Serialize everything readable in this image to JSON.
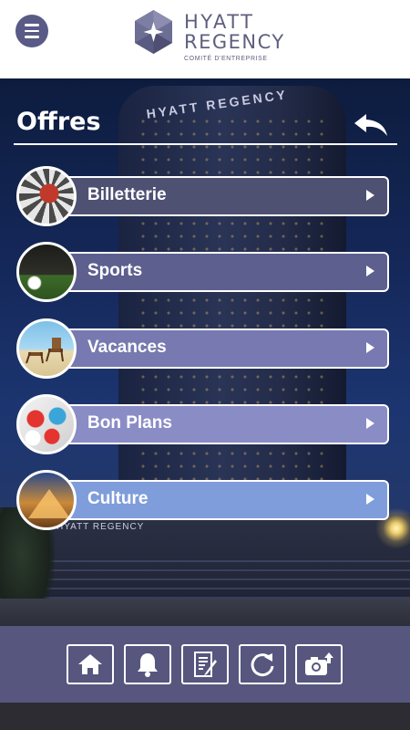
{
  "header": {
    "menu_icon": "hamburger-menu-icon",
    "logo": {
      "line1": "HYATT",
      "line2": "REGENCY",
      "tagline": "COMITÉ D'ENTREPRISE"
    }
  },
  "offres": {
    "title": "Offres",
    "back_icon": "back-arrow-icon"
  },
  "menu_items": [
    {
      "label": "Billetterie",
      "icon": "ferris-wheel-photo",
      "color": "#4f5173"
    },
    {
      "label": "Sports",
      "icon": "golf-ball-photo",
      "color": "#5d5f8e"
    },
    {
      "label": "Vacances",
      "icon": "beach-chairs-photo",
      "color": "#7779b0"
    },
    {
      "label": "Bon Plans",
      "icon": "discount-tags-photo",
      "color": "#8a8cc6"
    },
    {
      "label": "Culture",
      "icon": "louvre-pyramid-photo",
      "color": "#7f9ddb"
    }
  ],
  "background": {
    "tower_sign": "HYATT REGENCY",
    "base_sign": "HYATT REGENCY"
  },
  "toolbar": {
    "icons": [
      "home-icon",
      "bell-icon",
      "notes-icon",
      "refresh-icon",
      "camera-upload-icon"
    ]
  },
  "colors": {
    "header_bg": "#ffffff",
    "toolbar_bg": "#56567e",
    "brand": "#5e5f7e"
  }
}
